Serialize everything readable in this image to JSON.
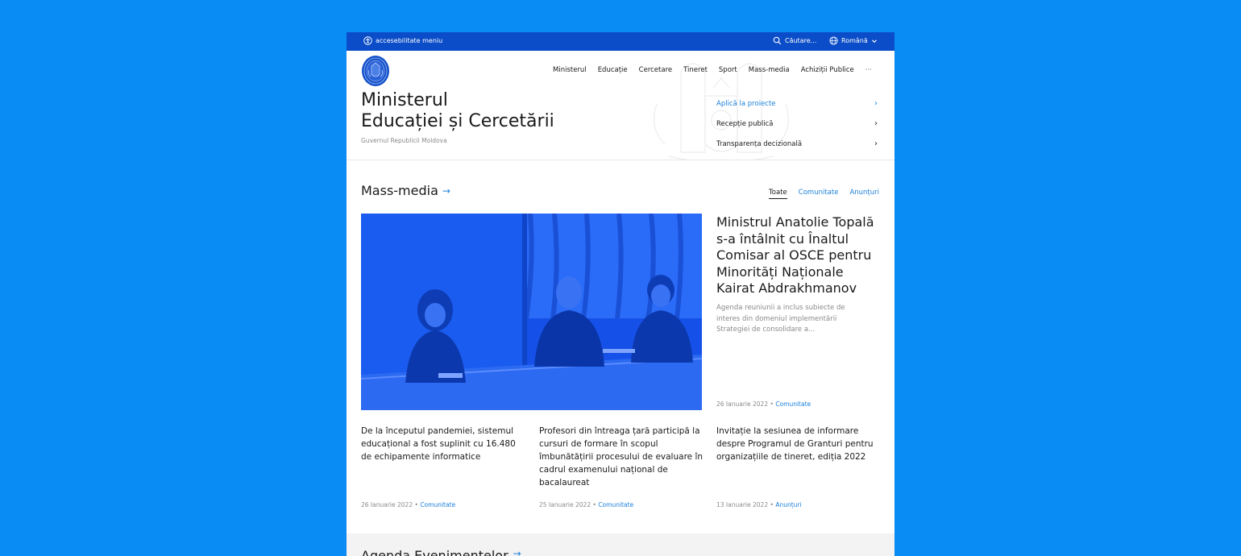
{
  "topbar": {
    "accessibility_label": "accesebilitate meniu",
    "search_label": "Căutare...",
    "language_label": "Română"
  },
  "header": {
    "title_line1": "Ministerul",
    "title_line2": "Educației și Cercetării",
    "subtitle": "Guvernul Republicii Moldova"
  },
  "nav": {
    "items": [
      "Ministerul",
      "Educație",
      "Cercetare",
      "Tineret",
      "Sport",
      "Mass-media",
      "Achiziții Publice"
    ],
    "more_label": "···"
  },
  "quick_links": [
    {
      "label": "Aplică la proiecte"
    },
    {
      "label": "Recepție publică"
    },
    {
      "label": "Transparența decizională"
    }
  ],
  "media": {
    "section_title": "Mass-media",
    "filters": [
      "Toate",
      "Comunitate",
      "Anunțuri"
    ],
    "featured": {
      "title": "Ministrul Anatolie Topală s-a întâlnit cu Înaltul Comisar al OSCE pentru Minorități Naționale Kairat Abdrakhmanov",
      "desc": "Agenda reuniunii a inclus subiecte de interes din domeniul implementării Strategiei de consolidare a...",
      "date": "26 Ianuarie 2022",
      "category": "Comunitate"
    },
    "cards": [
      {
        "title": "De la începutul pandemiei, sistemul educațional a fost suplinit cu 16.480 de echipamente informatice",
        "date": "26 Ianuarie 2022",
        "category": "Comunitate"
      },
      {
        "title": "Profesori din întreaga țară participă la cursuri de formare în scopul îmbunătățirii procesului de evaluare în cadrul examenului național de bacalaureat",
        "date": "25 Ianuarie 2022",
        "category": "Comunitate"
      },
      {
        "title": "Invitație la sesiunea de informare despre Programul de Granturi pentru organizațiile de tineret, ediția 2022",
        "date": "13 Ianuarie 2022",
        "category": "Anunțuri"
      }
    ],
    "separator": "•"
  },
  "agenda": {
    "title": "Agenda Evenimentelor"
  },
  "colors": {
    "background": "#0a8cf5",
    "topbar": "#0b4dc8",
    "accent": "#1a7fd9",
    "photo_tint": "#1550e8"
  },
  "icons": [
    "accessibility-icon",
    "search-icon",
    "globe-icon",
    "chevron-down-icon",
    "chevron-right-icon",
    "arrow-right-icon",
    "coat-of-arms-logo"
  ]
}
